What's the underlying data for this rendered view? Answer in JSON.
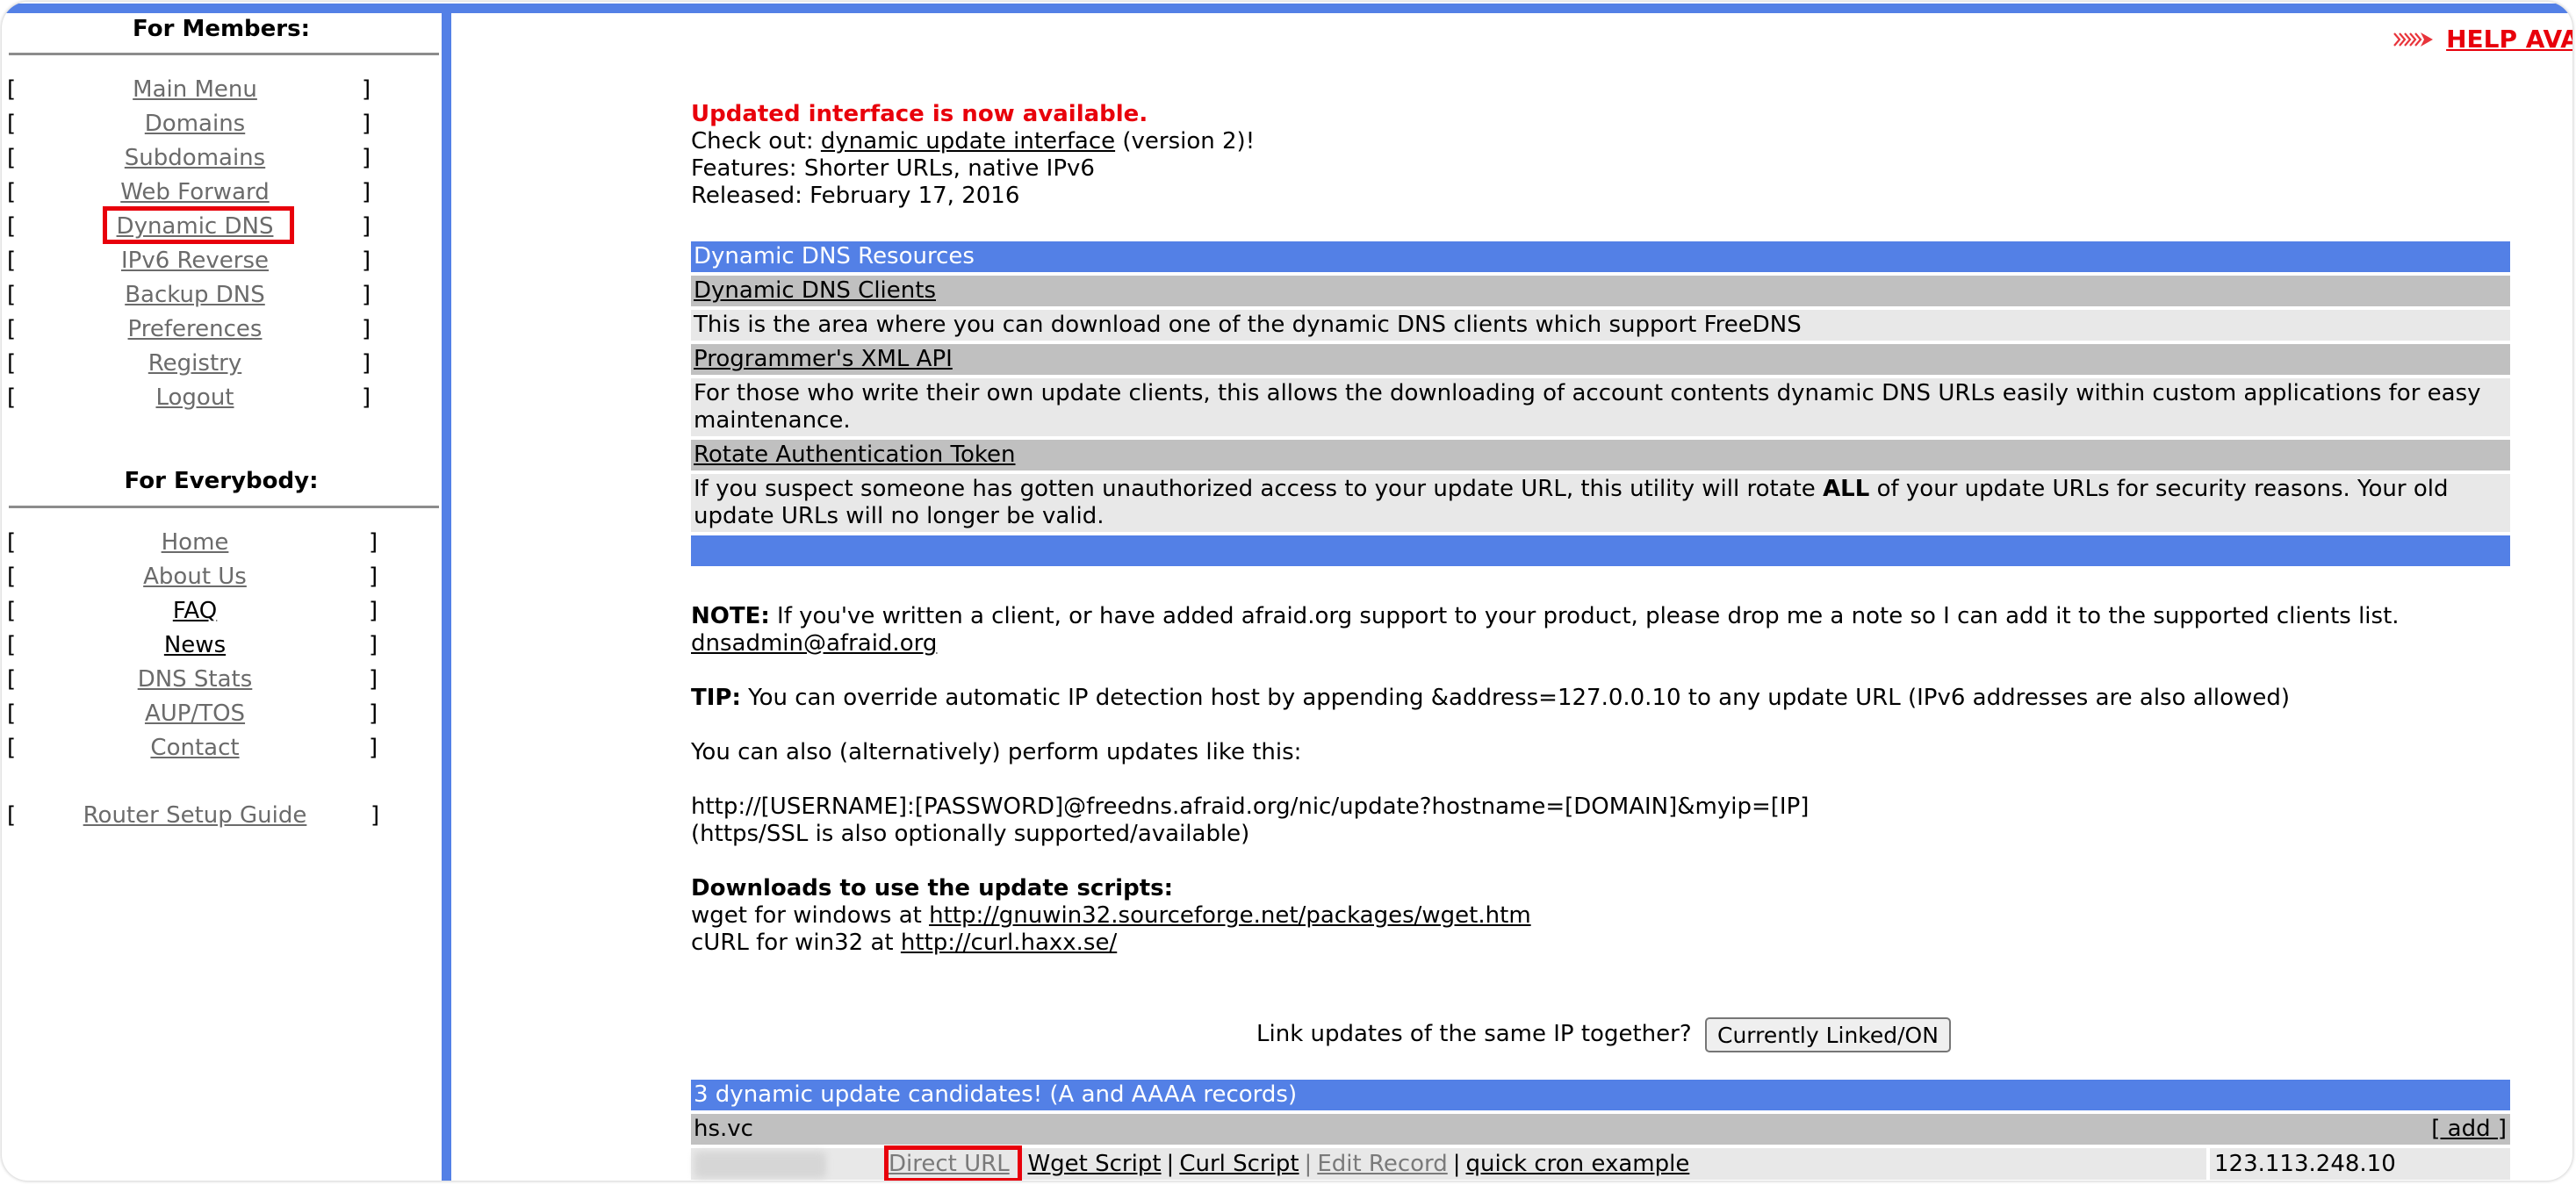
{
  "sidebar": {
    "members_heading": "For Members:",
    "members_items": [
      {
        "label": "Main Menu",
        "visited": true
      },
      {
        "label": "Domains",
        "visited": true
      },
      {
        "label": "Subdomains",
        "visited": true
      },
      {
        "label": "Web Forward",
        "visited": true
      },
      {
        "label": "Dynamic DNS",
        "visited": true,
        "highlighted": true
      },
      {
        "label": "IPv6 Reverse",
        "visited": true
      },
      {
        "label": "Backup DNS",
        "visited": true
      },
      {
        "label": "Preferences",
        "visited": true
      },
      {
        "label": "Registry",
        "visited": true
      },
      {
        "label": "Logout",
        "visited": true
      }
    ],
    "everybody_heading": "For Everybody:",
    "everybody_items": [
      {
        "label": "Home",
        "visited": true
      },
      {
        "label": "About Us",
        "visited": true
      },
      {
        "label": "FAQ",
        "visited": false
      },
      {
        "label": "News",
        "visited": false
      },
      {
        "label": "DNS Stats",
        "visited": true
      },
      {
        "label": "AUP/TOS",
        "visited": true
      },
      {
        "label": "Contact",
        "visited": true
      }
    ],
    "router_guide": "Router Setup Guide",
    "bracket_open": "[",
    "bracket_close": "]"
  },
  "help": {
    "icon": "red-arrow-icon",
    "label": "HELP AVAILABLE"
  },
  "announcement": {
    "title": "Updated interface is now available.",
    "checkout_prefix": "Check out: ",
    "checkout_link": "dynamic update interface",
    "checkout_suffix": " (version 2)!",
    "features": "Features: Shorter URLs, native IPv6",
    "released": "Released: February 17, 2016"
  },
  "resources": {
    "header": "Dynamic DNS Resources",
    "items": [
      {
        "title": "Dynamic DNS Clients",
        "description": "This is the area where you can download one of the dynamic DNS clients which support FreeDNS"
      },
      {
        "title": "Programmer's XML API",
        "description": "For those who write their own update clients, this allows the downloading of account contents dynamic DNS URLs easily within custom applications for easy maintenance."
      },
      {
        "title": "Rotate Authentication Token",
        "description_pre": "If you suspect someone has gotten unauthorized access to your update URL, this utility will rotate ",
        "description_bold": "ALL",
        "description_post": " of your update URLs for security reasons. Your old update URLs will no longer be valid."
      }
    ]
  },
  "note": {
    "label": "NOTE:",
    "text": " If you've written a client, or have added afraid.org support to your product, please drop me a note so I can add it to the supported clients list.",
    "email": "dnsadmin@afraid.org"
  },
  "tip": {
    "label": "TIP:",
    "text": " You can override automatic IP detection host by appending &address=127.0.0.10 to any update URL (IPv6 addresses are also allowed)"
  },
  "alt_update": {
    "intro": "You can also (alternatively) perform updates like this:",
    "url": "http://[USERNAME]:[PASSWORD]@freedns.afraid.org/nic/update?hostname=[DOMAIN]&myip=[IP]",
    "ssl_note": "(https/SSL is also optionally supported/available)"
  },
  "downloads": {
    "heading": "Downloads to use the update scripts:",
    "wget_prefix": "wget for windows at ",
    "wget_link": "http://gnuwin32.sourceforge.net/packages/wget.htm",
    "curl_prefix": "cURL for win32 at ",
    "curl_link": "http://curl.haxx.se/"
  },
  "link_updates": {
    "question": "Link updates of the same IP together?",
    "button": "Currently Linked/ON"
  },
  "candidates": {
    "header": "3 dynamic update candidates! (A and AAAA records)",
    "domain": "hs.vc",
    "add_label": "[ add ]",
    "rows": [
      {
        "name_redacted": true,
        "actions": [
          {
            "label": "Direct URL",
            "visited": true,
            "highlighted": true
          },
          {
            "label": "Wget Script",
            "visited": false
          },
          {
            "label": "Curl Script",
            "visited": false
          },
          {
            "label": "Edit Record",
            "visited": true
          },
          {
            "label": "quick cron example",
            "visited": false
          }
        ],
        "ip": "123.113.248.10"
      }
    ]
  },
  "colors": {
    "accent_blue": "#5380e6",
    "row_gray": "#c0c0c0",
    "row_light": "#e8e8e8",
    "alert_red": "#e8000b",
    "visited_link": "#6b6b6b"
  }
}
